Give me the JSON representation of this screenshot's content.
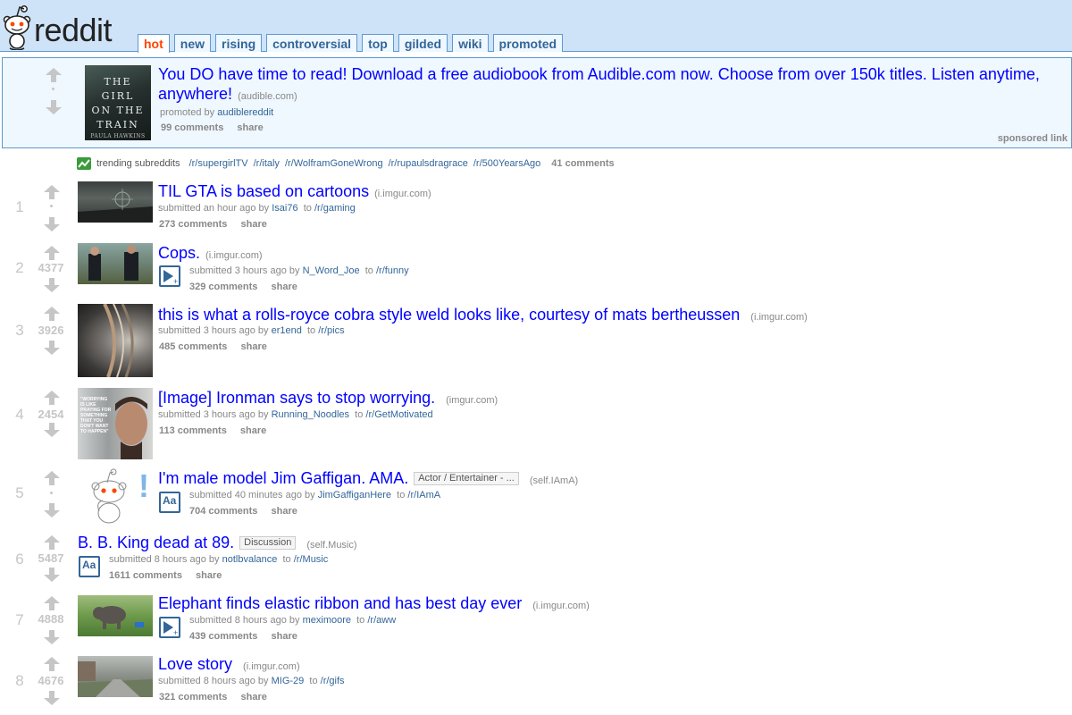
{
  "header": {
    "logo_text": "reddit",
    "tabs": [
      {
        "label": "hot",
        "selected": true
      },
      {
        "label": "new",
        "selected": false
      },
      {
        "label": "rising",
        "selected": false
      },
      {
        "label": "controversial",
        "selected": false
      },
      {
        "label": "top",
        "selected": false
      },
      {
        "label": "gilded",
        "selected": false
      },
      {
        "label": "wiki",
        "selected": false
      },
      {
        "label": "promoted",
        "selected": false
      }
    ]
  },
  "ad": {
    "thumb_lines": [
      "THE",
      "GIRL",
      "ON THE",
      "TRAIN"
    ],
    "thumb_author": "PAULA HAWKINS",
    "title": "You DO have time to read! Download a free audiobook from Audible.com now. Choose from over 150k titles. Listen anytime, anywhere!",
    "domain": "(audible.com)",
    "tagline_prefix": "promoted by",
    "author": "audiblereddit",
    "comments": "99 comments",
    "share": "share",
    "sponsored": "sponsored link"
  },
  "trending": {
    "label": "trending subreddits",
    "links": [
      "/r/supergirlTV",
      "/r/italy",
      "/r/WolframGoneWrong",
      "/r/rupaulsdragrace",
      "/r/500YearsAgo"
    ],
    "comments": "41 comments"
  },
  "posts": [
    {
      "rank": "1",
      "score": "",
      "title": "TIL GTA is based on cartoons",
      "domain": "(i.imgur.com)",
      "time": "submitted an hour ago by",
      "author": "Isai76",
      "to": "to",
      "subreddit": "/r/gaming",
      "comments": "273 comments",
      "share": "share"
    },
    {
      "rank": "2",
      "score": "4377",
      "title": "Cops.",
      "domain": "(i.imgur.com)",
      "time": "submitted 3 hours ago by",
      "author": "N_Word_Joe",
      "to": "to",
      "subreddit": "/r/funny",
      "comments": "329 comments",
      "share": "share"
    },
    {
      "rank": "3",
      "score": "3926",
      "title": "this is what a rolls-royce cobra style weld looks like, courtesy of mats bertheussen",
      "domain": "(i.imgur.com)",
      "time": "submitted 3 hours ago by",
      "author": "er1end",
      "to": "to",
      "subreddit": "/r/pics",
      "comments": "485 comments",
      "share": "share"
    },
    {
      "rank": "4",
      "score": "2454",
      "title": "[Image] Ironman says to stop worrying.",
      "domain": "(imgur.com)",
      "time": "submitted 3 hours ago by",
      "author": "Running_Noodles",
      "to": "to",
      "subreddit": "/r/GetMotivated",
      "comments": "113 comments",
      "share": "share",
      "thumb_text": "\"WORRYING IS LIKE PRAYING FOR SOMETHING THAT YOU DON'T WANT TO HAPPEN\""
    },
    {
      "rank": "5",
      "score": "",
      "title": "I'm male model Jim Gaffigan. AMA.",
      "flair": "Actor / Entertainer - ...",
      "domain": "(self.IAmA)",
      "time": "submitted 40 minutes ago by",
      "author": "JimGaffiganHere",
      "to": "to",
      "subreddit": "/r/IAmA",
      "comments": "704 comments",
      "share": "share",
      "exclaim": "!"
    },
    {
      "rank": "6",
      "score": "5487",
      "title": "B. B. King dead at 89.",
      "flair": "Discussion",
      "domain": "(self.Music)",
      "time": "submitted 8 hours ago by",
      "author": "notlbvalance",
      "to": "to",
      "subreddit": "/r/Music",
      "comments": "1611 comments",
      "share": "share"
    },
    {
      "rank": "7",
      "score": "4888",
      "title": "Elephant finds elastic ribbon and has best day ever",
      "domain": "(i.imgur.com)",
      "time": "submitted 8 hours ago by",
      "author": "meximoore",
      "to": "to",
      "subreddit": "/r/aww",
      "comments": "439 comments",
      "share": "share"
    },
    {
      "rank": "8",
      "score": "4676",
      "title": "Love story",
      "domain": "(i.imgur.com)",
      "time": "submitted 8 hours ago by",
      "author": "MIG-29",
      "to": "to",
      "subreddit": "/r/gifs",
      "comments": "321 comments",
      "share": "share"
    }
  ],
  "expando_labels": {
    "text": "Aa"
  },
  "colors": {
    "link": "#0000ff",
    "header_bg": "#cee3f8",
    "selected_tab": "#ff4500",
    "meta_link": "#336699"
  }
}
